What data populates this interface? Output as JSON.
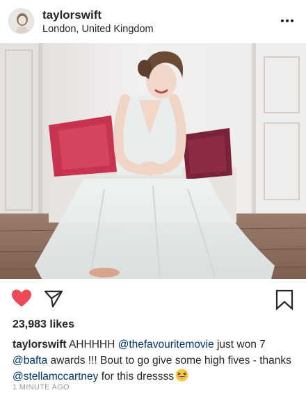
{
  "post": {
    "username": "taylorswift",
    "location": "London, United Kingdom",
    "more_icon": "more-horizontal-icon",
    "likes_text": "23,983 likes",
    "timestamp": "1 MINUTE AGO"
  },
  "actions": {
    "like_icon": "heart-filled-icon",
    "share_icon": "paper-plane-icon",
    "save_icon": "bookmark-icon",
    "like_color": "#ed4956"
  },
  "caption": {
    "username": "taylorswift",
    "text_1": " AHHHHH ",
    "mention_1": "@thefavouritemovie",
    "text_2": " just won 7 ",
    "mention_2": "@bafta",
    "text_3": " awards !!! Bout to go give some high fives - thanks ",
    "mention_3": "@stellamccartney",
    "text_4": " for this dressss",
    "emoji_icon": "grinning-squinting-face-emoji",
    "mention_color": "#003569"
  }
}
